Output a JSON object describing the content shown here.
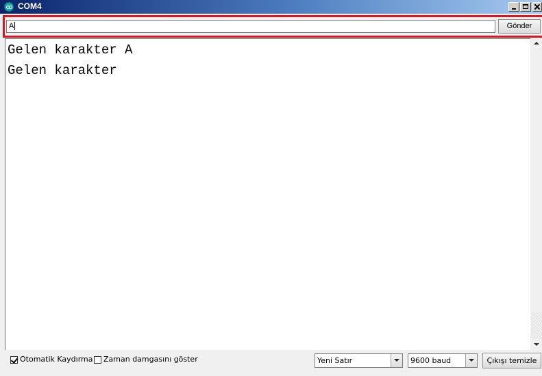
{
  "window": {
    "title": "COM4"
  },
  "send": {
    "input_value": "A",
    "button_label": "Gönder"
  },
  "output": {
    "lines": [
      "Gelen karakter A",
      "Gelen karakter"
    ]
  },
  "footer": {
    "autoscroll_label": "Otomatik Kaydırma",
    "autoscroll_checked": true,
    "timestamp_label": "Zaman damgasını göster",
    "timestamp_checked": false,
    "line_ending_selected": "Yeni Satır",
    "baud_selected": "9600 baud",
    "clear_label": "Çıkışı temizle"
  },
  "colors": {
    "highlight": "#e0141e",
    "titlebar_start": "#0a246a",
    "titlebar_end": "#a6caf0"
  }
}
